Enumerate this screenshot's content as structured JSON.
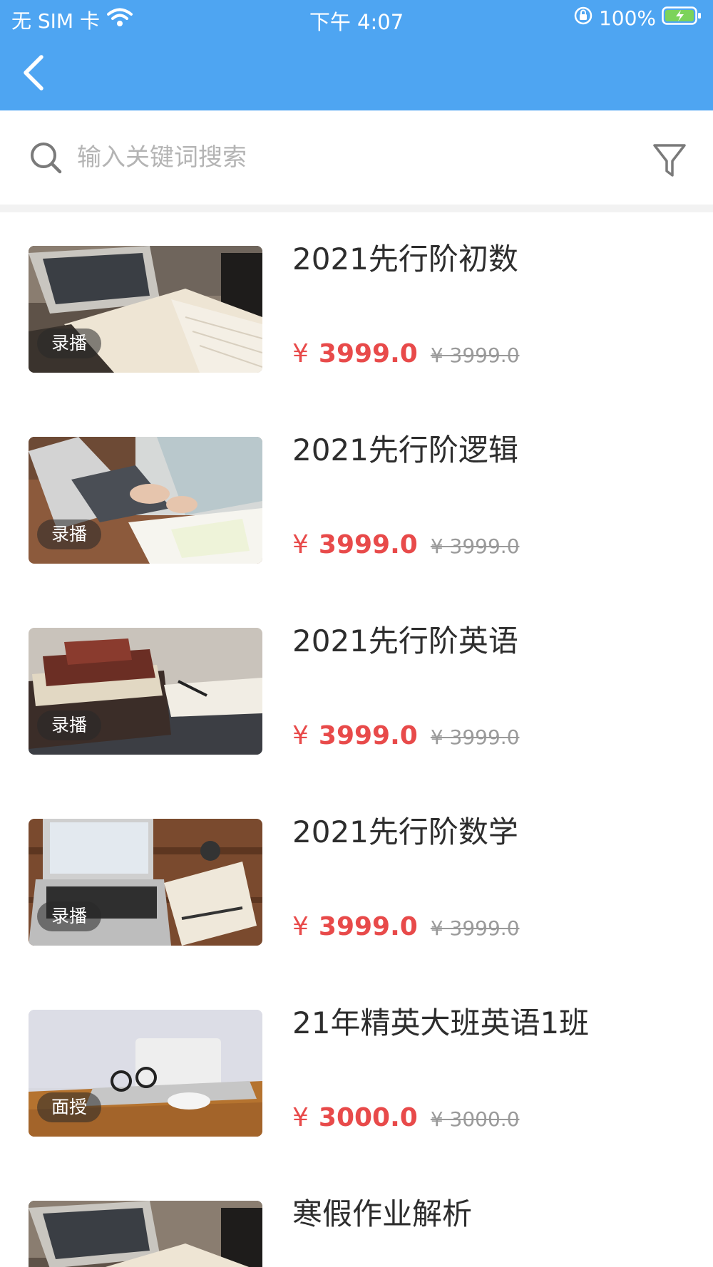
{
  "status_bar": {
    "carrier": "无 SIM 卡",
    "time": "下午 4:07",
    "battery": "100%"
  },
  "search": {
    "placeholder": "输入关键词搜索"
  },
  "courses": [
    {
      "title": "2021先行阶初数",
      "tag": "录播",
      "currency": "¥",
      "price": "3999.0",
      "original_price": "¥ 3999.0"
    },
    {
      "title": "2021先行阶逻辑",
      "tag": "录播",
      "currency": "¥",
      "price": "3999.0",
      "original_price": "¥ 3999.0"
    },
    {
      "title": "2021先行阶英语",
      "tag": "录播",
      "currency": "¥",
      "price": "3999.0",
      "original_price": "¥ 3999.0"
    },
    {
      "title": "2021先行阶数学",
      "tag": "录播",
      "currency": "¥",
      "price": "3999.0",
      "original_price": "¥ 3999.0"
    },
    {
      "title": "21年精英大班英语1班",
      "tag": "面授",
      "currency": "¥",
      "price": "3000.0",
      "original_price": "¥ 3000.0"
    },
    {
      "title": "寒假作业解析"
    }
  ],
  "colors": {
    "header": "#4ea5f2",
    "price": "#e84a4a",
    "original_price": "#9a9a9a"
  }
}
